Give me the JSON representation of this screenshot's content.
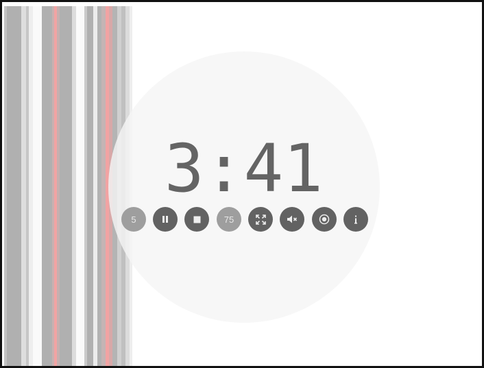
{
  "timer": {
    "display": "3:41"
  },
  "controls": {
    "step_label": "5",
    "volume_label": "75",
    "buttons": [
      {
        "name": "step-5-button",
        "icon": "number-5"
      },
      {
        "name": "pause-button",
        "icon": "pause-icon"
      },
      {
        "name": "stop-button",
        "icon": "stop-icon"
      },
      {
        "name": "volume-75-button",
        "icon": "number-75"
      },
      {
        "name": "fullscreen-button",
        "icon": "fullscreen-icon"
      },
      {
        "name": "mute-button",
        "icon": "mute-icon"
      },
      {
        "name": "record-button",
        "icon": "record-icon"
      },
      {
        "name": "info-button",
        "icon": "info-icon"
      }
    ]
  },
  "colors": {
    "button_dark": "#626262",
    "button_light": "#9e9e9e",
    "stripe_gray": "#b4b4b4",
    "stripe_red": "#f2a3a3",
    "halo": "#f5f5f5",
    "clock_text": "#646464"
  }
}
